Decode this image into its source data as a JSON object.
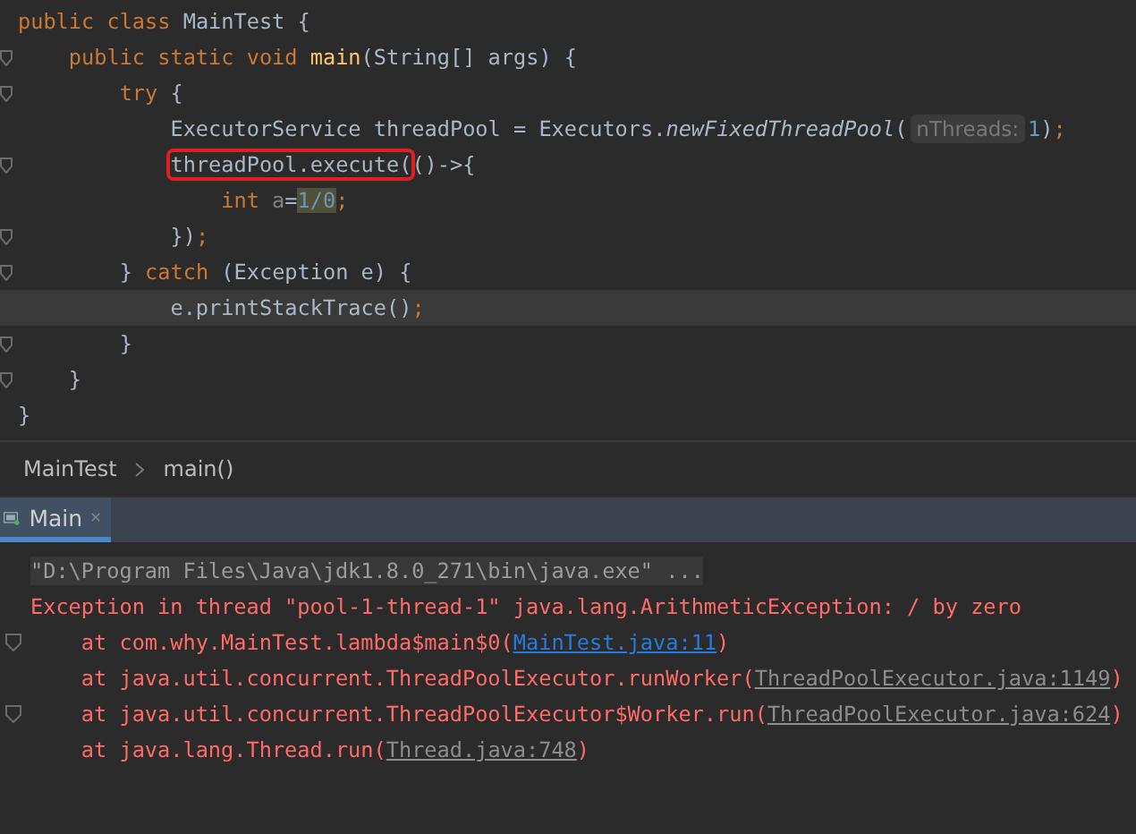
{
  "editor": {
    "lines": [
      {
        "fold": false,
        "current": false,
        "tokens": [
          {
            "kind": "kw",
            "text": "public class "
          },
          {
            "kind": "text",
            "text": "MainTest {"
          }
        ]
      },
      {
        "fold": true,
        "current": false,
        "tokens": [
          {
            "kind": "kw",
            "text": "    public static void "
          },
          {
            "kind": "fn",
            "text": "main"
          },
          {
            "kind": "text",
            "text": "(String[] args) {"
          }
        ]
      },
      {
        "fold": true,
        "current": false,
        "tokens": [
          {
            "kind": "kw",
            "text": "        try "
          },
          {
            "kind": "text",
            "text": "{"
          }
        ]
      },
      {
        "fold": false,
        "current": false,
        "tokens": [
          {
            "kind": "text",
            "text": "            ExecutorService threadPool = Executors."
          },
          {
            "kind": "italic",
            "text": "newFixedThreadPool"
          },
          {
            "kind": "text",
            "text": "("
          },
          {
            "kind": "hint",
            "text": "nThreads:"
          },
          {
            "kind": "num",
            "text": "1"
          },
          {
            "kind": "text",
            "text": ")"
          },
          {
            "kind": "kw",
            "text": ";"
          }
        ]
      },
      {
        "fold": true,
        "current": false,
        "tokens": [
          {
            "kind": "boxed",
            "text": "            threadPool.execute("
          },
          {
            "kind": "text",
            "text": "()->{"
          }
        ]
      },
      {
        "fold": false,
        "current": false,
        "tokens": [
          {
            "kind": "kw",
            "text": "                int "
          },
          {
            "kind": "unused",
            "text": "a"
          },
          {
            "kind": "text",
            "text": "="
          },
          {
            "kind": "num-highlight",
            "text": "1/0"
          },
          {
            "kind": "kw",
            "text": ";"
          }
        ]
      },
      {
        "fold": true,
        "current": false,
        "tokens": [
          {
            "kind": "text",
            "text": "            })"
          },
          {
            "kind": "kw",
            "text": ";"
          }
        ]
      },
      {
        "fold": true,
        "current": false,
        "tokens": [
          {
            "kind": "text",
            "text": "        } "
          },
          {
            "kind": "kw",
            "text": "catch "
          },
          {
            "kind": "text",
            "text": "(Exception e) {"
          }
        ]
      },
      {
        "fold": false,
        "current": true,
        "tokens": [
          {
            "kind": "text",
            "text": "            e.printStackTrace()"
          },
          {
            "kind": "kw",
            "text": ";"
          }
        ]
      },
      {
        "fold": true,
        "current": false,
        "tokens": [
          {
            "kind": "text",
            "text": "        }"
          }
        ]
      },
      {
        "fold": true,
        "current": false,
        "tokens": [
          {
            "kind": "text",
            "text": "    }"
          }
        ]
      },
      {
        "fold": false,
        "current": false,
        "tokens": [
          {
            "kind": "text",
            "text": "}"
          }
        ]
      }
    ]
  },
  "breadcrumb": [
    "MainTest",
    "main()"
  ],
  "run_tabs": [
    {
      "label": "Main",
      "selected": true
    }
  ],
  "console": [
    {
      "kind": "command",
      "fold": false,
      "text": "\"D:\\Program Files\\Java\\jdk1.8.0_271\\bin\\java.exe\" ..."
    },
    {
      "kind": "error",
      "fold": false,
      "text": "Exception in thread \"pool-1-thread-1\" java.lang.ArithmeticException: / by zero"
    },
    {
      "kind": "stack",
      "fold": true,
      "text": "    at com.why.MainTest.lambda$main$0(",
      "link": "MainTest.java:11",
      "highlighted": true,
      "after": ")"
    },
    {
      "kind": "stack",
      "fold": false,
      "text": "    at java.util.concurrent.ThreadPoolExecutor.runWorker(",
      "link": "ThreadPoolExecutor.java:1149",
      "highlighted": false,
      "after": ")"
    },
    {
      "kind": "stack",
      "fold": true,
      "text": "    at java.util.concurrent.ThreadPoolExecutor$Worker.run(",
      "link": "ThreadPoolExecutor.java:624",
      "highlighted": false,
      "after": ")"
    },
    {
      "kind": "stack",
      "fold": false,
      "text": "    at java.lang.Thread.run(",
      "link": "Thread.java:748",
      "highlighted": false,
      "after": ")"
    }
  ]
}
